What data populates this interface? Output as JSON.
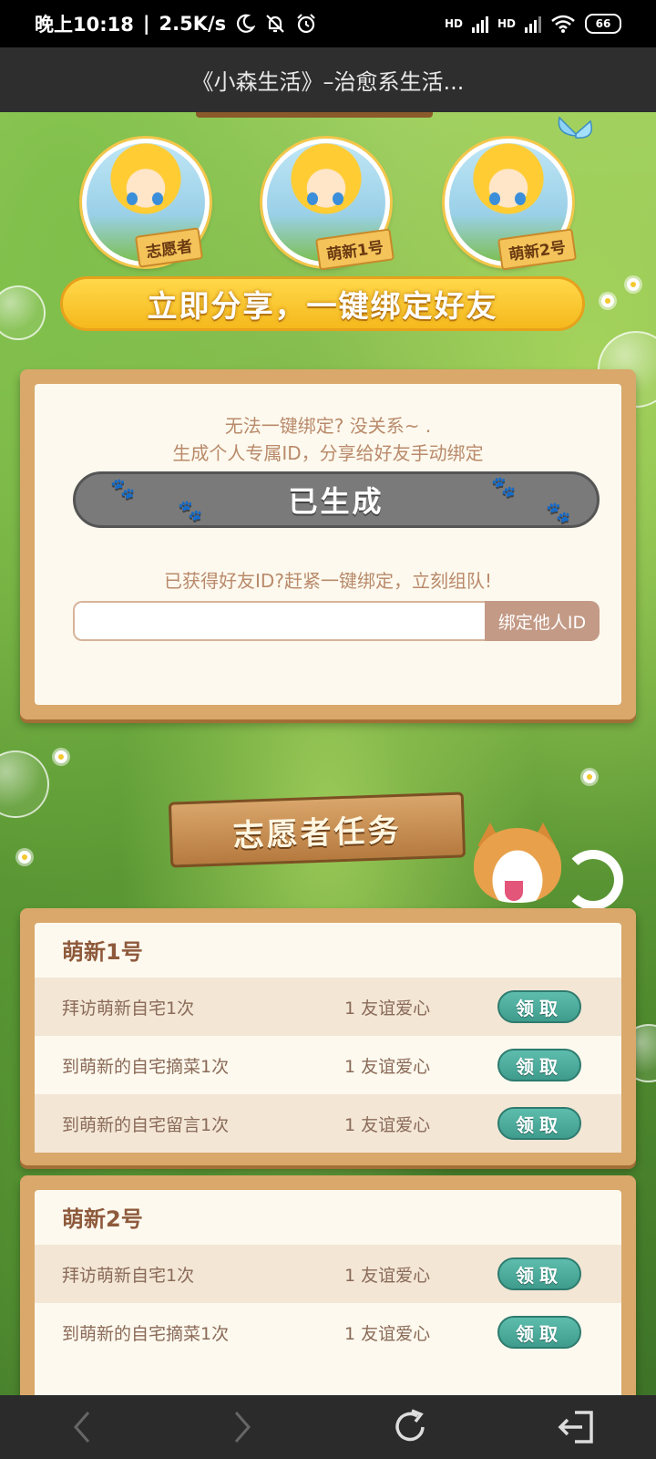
{
  "status_bar": {
    "time": "晚上10:18",
    "net_speed": "2.5K/s",
    "battery": "66",
    "signal1": "HD",
    "signal2": "HD"
  },
  "titlebar": {
    "title": "《小森生活》–治愈系生活..."
  },
  "avatars": [
    {
      "tag": "志愿者"
    },
    {
      "tag": "萌新1号"
    },
    {
      "tag": "萌新2号"
    }
  ],
  "share_button": "立即分享，一键绑定好友",
  "bind_panel": {
    "hint_line1": "无法一键绑定? 没关系~ .",
    "hint_line2": "生成个人专属ID，分享给好友手动绑定",
    "generate_label": "已生成",
    "friend_hint": "已获得好友ID?赶紧一键绑定，立刻组队!",
    "input_value": "",
    "input_placeholder": "",
    "bind_label": "绑定他人ID"
  },
  "volunteer_sign": "志愿者任务",
  "task_groups": [
    {
      "title": "萌新1号",
      "tasks": [
        {
          "name": "拜访萌新自宅1次",
          "reward": "1 友谊爱心",
          "action": "领取"
        },
        {
          "name": "到萌新的自宅摘菜1次",
          "reward": "1 友谊爱心",
          "action": "领取"
        },
        {
          "name": "到萌新的自宅留言1次",
          "reward": "1 友谊爱心",
          "action": "领取"
        }
      ]
    },
    {
      "title": "萌新2号",
      "tasks": [
        {
          "name": "拜访萌新自宅1次",
          "reward": "1 友谊爱心",
          "action": "领取"
        },
        {
          "name": "到萌新的自宅摘菜1次",
          "reward": "1 友谊爱心",
          "action": "领取"
        }
      ]
    }
  ],
  "nav_icons": [
    "back-icon",
    "forward-icon",
    "refresh-icon",
    "exit-icon"
  ]
}
